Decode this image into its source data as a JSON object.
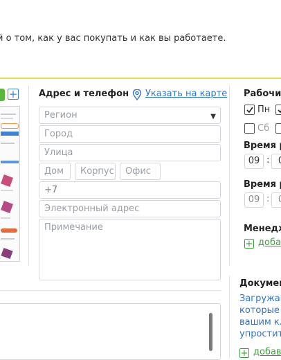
{
  "intro_text": "й о том, как у вас покупать и как вы работаете.",
  "colors": {
    "accent_rule": "#e5e04a",
    "link": "#2f73c9",
    "green": "#3aa23a"
  },
  "address": {
    "title": "Адрес и телефон",
    "map_link": "Указать на карте",
    "region_placeholder": "Регион",
    "city_placeholder": "Город",
    "street_placeholder": "Улица",
    "house_placeholder": "Дом",
    "building_placeholder": "Корпус",
    "office_placeholder": "Офис",
    "phone_value": "+7",
    "email_placeholder": "Электронный адрес",
    "note_placeholder": "Примечание"
  },
  "schedule": {
    "title": "Рабочие",
    "days": [
      {
        "label": "Пн",
        "checked": true
      },
      {
        "label": "Сб",
        "checked": false
      }
    ],
    "time_label_1": "Время р",
    "time_1_hour": "09",
    "time_1_min": "0",
    "time_label_2": "Время р",
    "time_2_hour": "09",
    "time_2_min": "0"
  },
  "managers": {
    "title": "Менедж",
    "add_label": "доба"
  },
  "documents": {
    "title": "Документ",
    "desc_lines": [
      "Загружай",
      "которые к",
      "вашим кл",
      "упростит"
    ],
    "add_label": "добав"
  },
  "icons": {
    "map": "map-pin-icon",
    "add": "plus-icon",
    "check": "check-icon",
    "dropdown": "caret-down-icon"
  }
}
